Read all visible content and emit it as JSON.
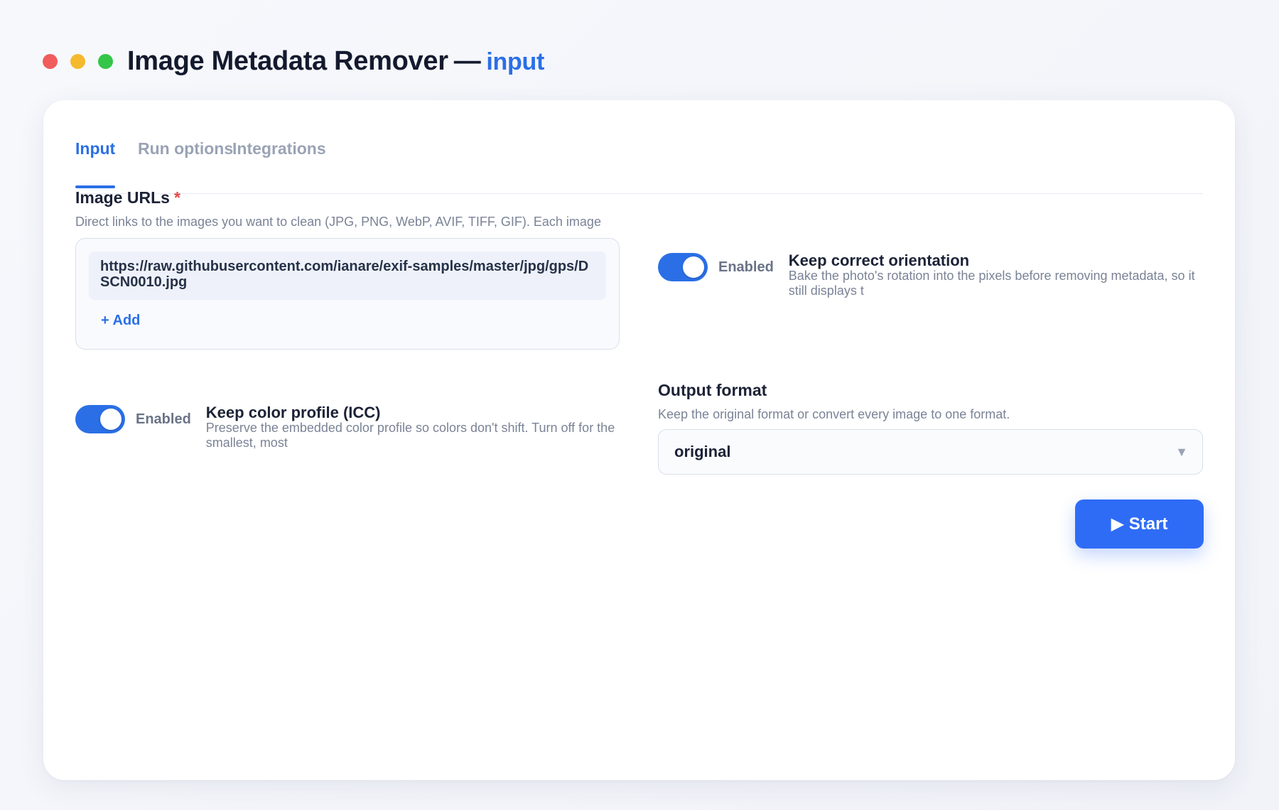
{
  "window": {
    "title": "Image Metadata Remover",
    "separator": "—",
    "subtitle": "input"
  },
  "tabs": [
    {
      "label": "Input",
      "active": true
    },
    {
      "label": "Run options",
      "active": false
    },
    {
      "label": "Integrations",
      "active": false
    }
  ],
  "image_urls": {
    "label": "Image URLs",
    "required_mark": "*",
    "help": "Direct links to the images you want to clean (JPG, PNG, WebP, AVIF, TIFF, GIF). Each image",
    "items": [
      "https://raw.githubusercontent.com/ianare/exif-samples/master/jpg/gps/DSCN0010.jpg"
    ],
    "add_label": "+ Add"
  },
  "keep_orientation": {
    "state_label": "Enabled",
    "enabled": true,
    "title": "Keep correct orientation",
    "description": "Bake the photo's rotation into the pixels before removing metadata, so it still displays t"
  },
  "keep_color_profile": {
    "state_label": "Enabled",
    "enabled": true,
    "title": "Keep color profile (ICC)",
    "description": "Preserve the embedded color profile so colors don't shift. Turn off for the smallest, most"
  },
  "output_format": {
    "label": "Output format",
    "help": "Keep the original format or convert every image to one format.",
    "value": "original",
    "caret": "▼"
  },
  "actions": {
    "start_label": "▶ Start"
  },
  "colors": {
    "accent": "#2b6fe6",
    "required": "#e5484d",
    "traffic_red": "#f15b5b",
    "traffic_yellow": "#f5b92e",
    "traffic_green": "#33c648"
  }
}
